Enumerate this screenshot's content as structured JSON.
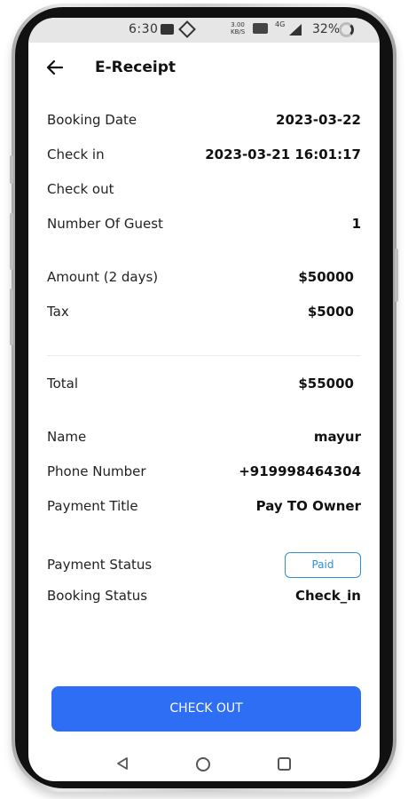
{
  "status_bar": {
    "time": "6:30",
    "speed_top": "3.00",
    "speed_unit": "KB/S",
    "network": "4G",
    "battery": "32%"
  },
  "header": {
    "title": "E-Receipt",
    "back_icon": "arrow-left-icon"
  },
  "booking": {
    "booking_date": {
      "label": "Booking Date",
      "value": "2023-03-22"
    },
    "check_in": {
      "label": "Check in",
      "value": "2023-03-21 16:01:17"
    },
    "check_out": {
      "label": "Check out",
      "value": ""
    },
    "guests": {
      "label": "Number Of Guest",
      "value": "1"
    }
  },
  "charges": {
    "amount": {
      "label": "Amount (2 days)",
      "value": "$50000"
    },
    "tax": {
      "label": "Tax",
      "value": "$5000"
    },
    "total": {
      "label": "Total",
      "value": "$55000"
    }
  },
  "customer": {
    "name": {
      "label": "Name",
      "value": "mayur"
    },
    "phone": {
      "label": "Phone Number",
      "value": "+919998464304"
    },
    "payment_title": {
      "label": "Payment Title",
      "value": "Pay TO Owner"
    }
  },
  "status": {
    "payment": {
      "label": "Payment Status",
      "value": "Paid"
    },
    "booking": {
      "label": "Booking Status",
      "value": "Check_in"
    }
  },
  "actions": {
    "checkout_label": "CHECK OUT"
  },
  "colors": {
    "accent": "#2e6ef5",
    "badge": "#2f8fd6"
  }
}
